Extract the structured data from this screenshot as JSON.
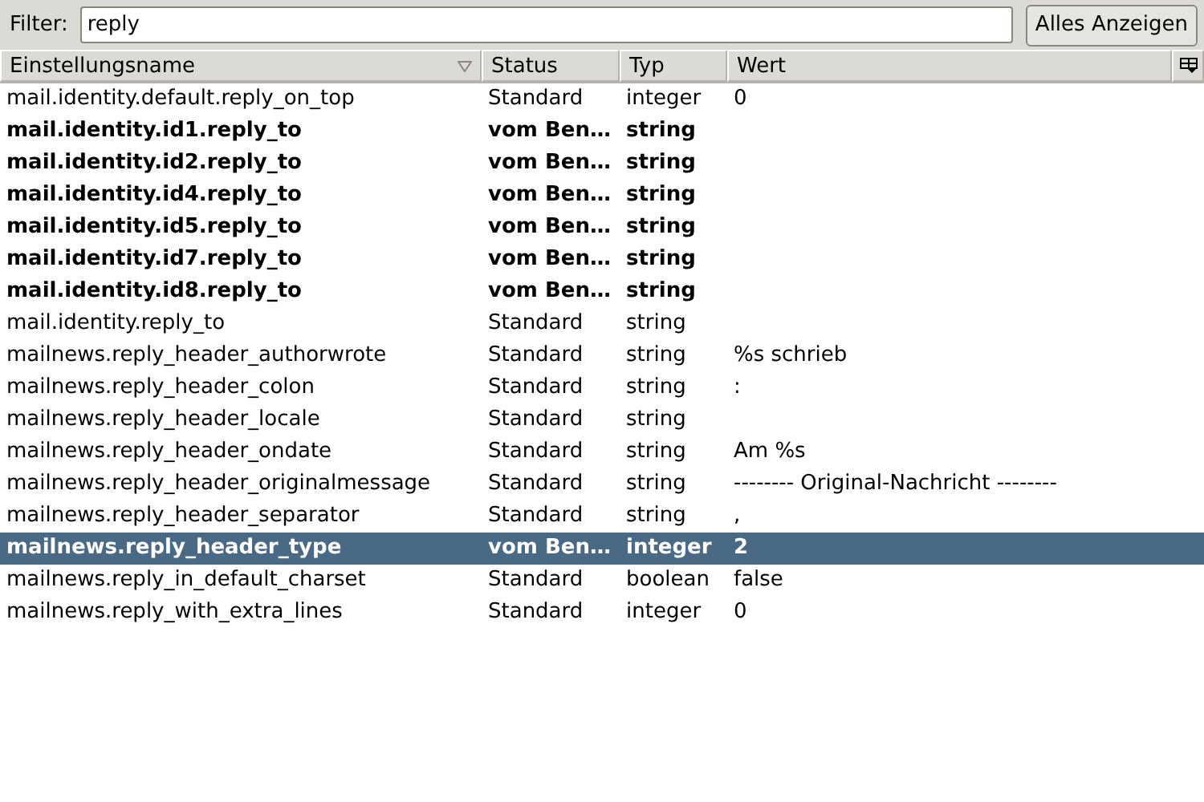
{
  "filter": {
    "label": "Filter:",
    "value": "reply"
  },
  "show_all_button": "Alles Anzeigen",
  "columns": [
    {
      "label": "Einstellungsname",
      "sorted": true
    },
    {
      "label": "Status",
      "sorted": false
    },
    {
      "label": "Typ",
      "sorted": false
    },
    {
      "label": "Wert",
      "sorted": false
    }
  ],
  "rows": [
    {
      "name": "mail.identity.default.reply_on_top",
      "status": "Standard",
      "type": "integer",
      "value": "0",
      "modified": false,
      "selected": false
    },
    {
      "name": "mail.identity.id1.reply_to",
      "status": "vom Ben…",
      "type": "string",
      "value": "",
      "modified": true,
      "selected": false
    },
    {
      "name": "mail.identity.id2.reply_to",
      "status": "vom Ben…",
      "type": "string",
      "value": "",
      "modified": true,
      "selected": false
    },
    {
      "name": "mail.identity.id4.reply_to",
      "status": "vom Ben…",
      "type": "string",
      "value": "",
      "modified": true,
      "selected": false
    },
    {
      "name": "mail.identity.id5.reply_to",
      "status": "vom Ben…",
      "type": "string",
      "value": "",
      "modified": true,
      "selected": false
    },
    {
      "name": "mail.identity.id7.reply_to",
      "status": "vom Ben…",
      "type": "string",
      "value": "",
      "modified": true,
      "selected": false
    },
    {
      "name": "mail.identity.id8.reply_to",
      "status": "vom Ben…",
      "type": "string",
      "value": "",
      "modified": true,
      "selected": false
    },
    {
      "name": "mail.identity.reply_to",
      "status": "Standard",
      "type": "string",
      "value": "",
      "modified": false,
      "selected": false
    },
    {
      "name": "mailnews.reply_header_authorwrote",
      "status": "Standard",
      "type": "string",
      "value": "%s schrieb",
      "modified": false,
      "selected": false
    },
    {
      "name": "mailnews.reply_header_colon",
      "status": "Standard",
      "type": "string",
      "value": ":",
      "modified": false,
      "selected": false
    },
    {
      "name": "mailnews.reply_header_locale",
      "status": "Standard",
      "type": "string",
      "value": "",
      "modified": false,
      "selected": false
    },
    {
      "name": "mailnews.reply_header_ondate",
      "status": "Standard",
      "type": "string",
      "value": "Am %s",
      "modified": false,
      "selected": false
    },
    {
      "name": "mailnews.reply_header_originalmessage",
      "status": "Standard",
      "type": "string",
      "value": "-------- Original-Nachricht --------",
      "modified": false,
      "selected": false
    },
    {
      "name": "mailnews.reply_header_separator",
      "status": "Standard",
      "type": "string",
      "value": ",",
      "modified": false,
      "selected": false
    },
    {
      "name": "mailnews.reply_header_type",
      "status": "vom Ben…",
      "type": "integer",
      "value": "2",
      "modified": true,
      "selected": true
    },
    {
      "name": "mailnews.reply_in_default_charset",
      "status": "Standard",
      "type": "boolean",
      "value": "false",
      "modified": false,
      "selected": false
    },
    {
      "name": "mailnews.reply_with_extra_lines",
      "status": "Standard",
      "type": "integer",
      "value": "0",
      "modified": false,
      "selected": false
    }
  ]
}
